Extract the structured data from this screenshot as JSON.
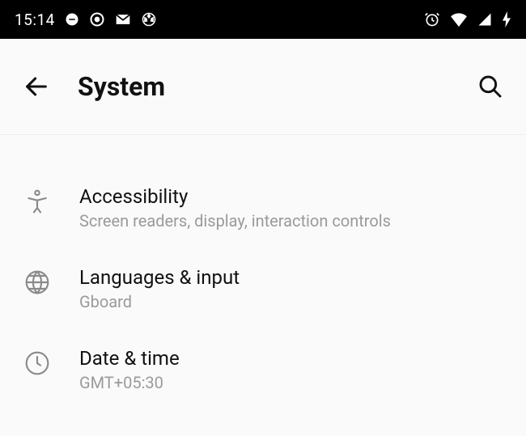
{
  "status_bar": {
    "time": "15:14"
  },
  "header": {
    "title": "System"
  },
  "settings": [
    {
      "icon": "accessibility",
      "title": "Accessibility",
      "subtitle": "Screen readers, display, interaction controls"
    },
    {
      "icon": "globe",
      "title": "Languages & input",
      "subtitle": "Gboard"
    },
    {
      "icon": "clock",
      "title": "Date & time",
      "subtitle": "GMT+05:30"
    }
  ]
}
